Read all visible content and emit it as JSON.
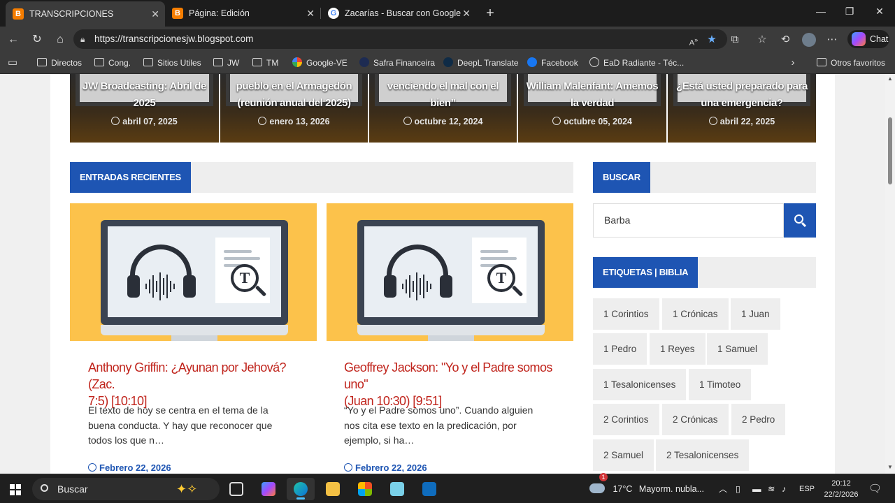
{
  "browser": {
    "tabs": [
      {
        "label": "TRANSCRIPCIONES",
        "icon": "blogger-icon",
        "active": true
      },
      {
        "label": "Página: Edición",
        "icon": "blogger-icon",
        "active": false
      },
      {
        "label": "Zacarías - Buscar con Google",
        "icon": "google-icon",
        "active": false
      }
    ],
    "url": "https://transcripcionesjw.blogspot.com",
    "chat_label": "Chat",
    "favorites": [
      {
        "label": "Directos",
        "icon": "folder-icon"
      },
      {
        "label": "Cong.",
        "icon": "folder-icon"
      },
      {
        "label": "Sitios Utiles",
        "icon": "folder-icon"
      },
      {
        "label": "JW",
        "icon": "folder-icon"
      },
      {
        "label": "TM",
        "icon": "folder-icon"
      },
      {
        "label": "Google-VE",
        "icon": "google-icon"
      },
      {
        "label": "Safra Financeira",
        "icon": "safra-icon"
      },
      {
        "label": "DeepL Translate",
        "icon": "deepl-icon"
      },
      {
        "label": "Facebook",
        "icon": "facebook-icon"
      },
      {
        "label": "EaD Radiante - Téc...",
        "icon": "globe-icon"
      }
    ],
    "other_favorites": "Otros favoritos"
  },
  "slider": [
    {
      "title_line1": "JW Broadcasting: Abril de",
      "title_line2": "2025",
      "date": "abril 07, 2025"
    },
    {
      "title_line1": "pueblo en el Armagedón",
      "title_line2": "(reunión anual del 2025)",
      "date": "enero 13, 2026"
    },
    {
      "title_line1": "venciendo el mal con el",
      "title_line2": "bien”",
      "date": "octubre 12, 2024"
    },
    {
      "title_line1": "William Malenfant: Amemos",
      "title_line2": "la verdad",
      "date": "octubre 05, 2024"
    },
    {
      "title_line1": "¿Está usted preparado para",
      "title_line2": "una emergencia?",
      "date": "abril 22, 2025"
    }
  ],
  "recent": {
    "heading": "ENTRADAS RECIENTES",
    "posts": [
      {
        "title_line1": "Anthony Griffin: ¿Ayunan por Jehová? (Zac.",
        "title_line2": "7:5) [10:10]",
        "excerpt_line1": "El texto de hoy se centra en el tema de la",
        "excerpt_line2": "buena conducta. Y hay que reconocer que",
        "excerpt_line3": "todos los que n…",
        "date": "Febrero 22, 2026"
      },
      {
        "title_line1": "Geoffrey Jackson: \"Yo y el Padre somos uno\"",
        "title_line2": "(Juan 10:30) [9:51]",
        "excerpt_line1": "“Yo y el Padre somos uno”. Cuando alguien",
        "excerpt_line2": "nos cita ese texto en la predicación, por",
        "excerpt_line3": "ejemplo, si ha…",
        "date": "Febrero 22, 2026"
      }
    ]
  },
  "search": {
    "heading": "BUSCAR",
    "value": "Barba"
  },
  "tags": {
    "heading": "ETIQUETAS | BIBLIA",
    "items": [
      "1 Corintios",
      "1 Crónicas",
      "1 Juan",
      "1 Pedro",
      "1 Reyes",
      "1 Samuel",
      "1 Tesalonicenses",
      "1 Timoteo",
      "2 Corintios",
      "2 Crónicas",
      "2 Pedro",
      "2 Samuel",
      "2 Tesalonicenses"
    ]
  },
  "taskbar": {
    "search_placeholder": "Buscar",
    "weather_temp": "17°C",
    "weather_text": "Mayorm. nubla...",
    "language": "ESP",
    "time": "20:12",
    "date": "22/2/2026",
    "weather_badge": "1"
  },
  "colors": {
    "accent_blue": "#1e55b3",
    "title_red": "#c0241c",
    "thumb_yellow": "#fcc24b"
  }
}
